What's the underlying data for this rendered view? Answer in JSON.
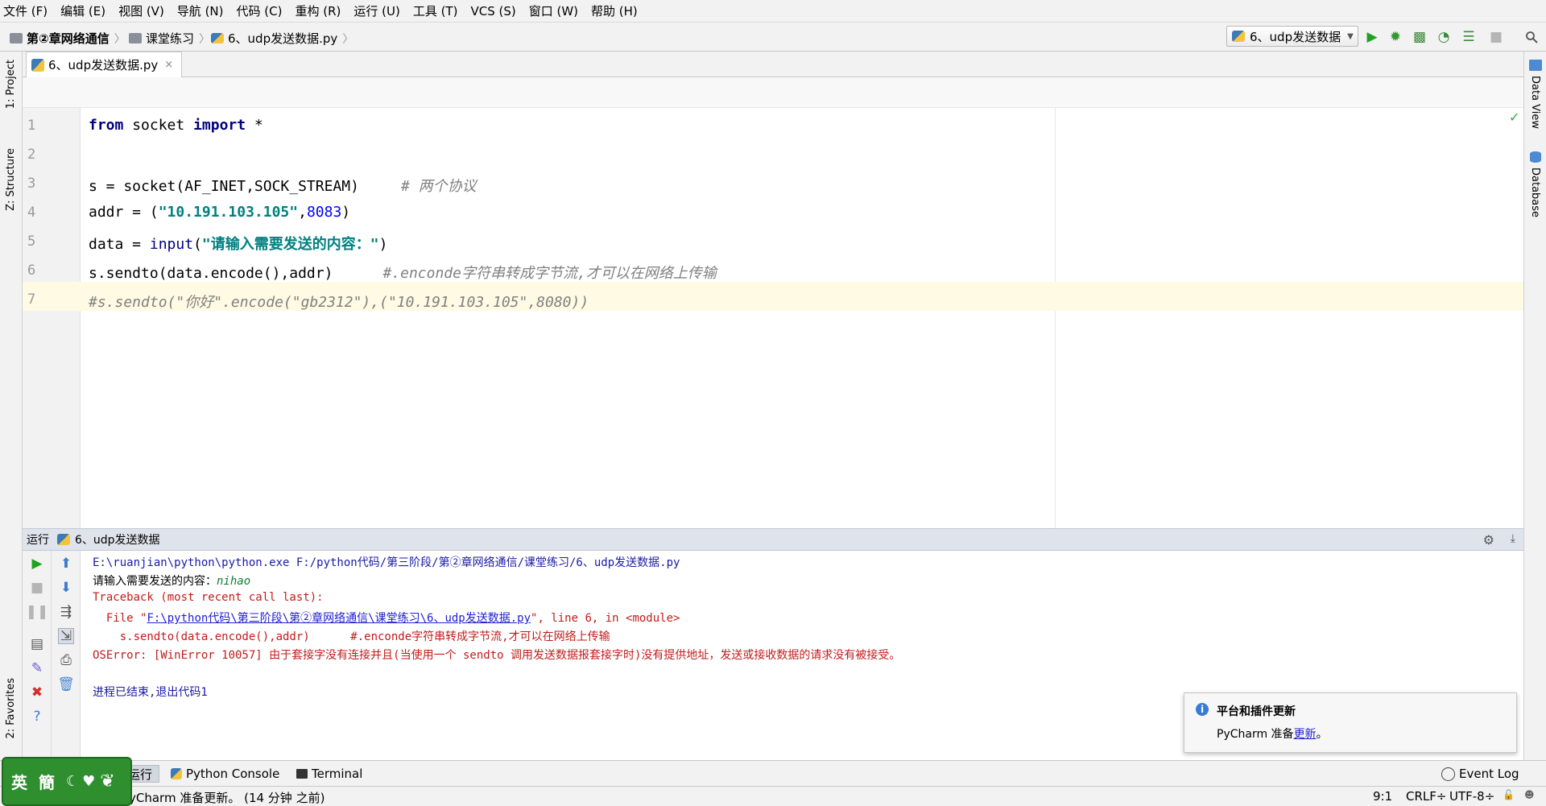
{
  "menu": [
    "文件 (F)",
    "编辑 (E)",
    "视图 (V)",
    "导航 (N)",
    "代码 (C)",
    "重构 (R)",
    "运行 (U)",
    "工具 (T)",
    "VCS (S)",
    "窗口 (W)",
    "帮助 (H)"
  ],
  "nav": {
    "crumb1": "第②章网络通信",
    "crumb2": "课堂练习",
    "crumb3": "6、udp发送数据.py",
    "sep": "〉"
  },
  "run_config": "6、udp发送数据",
  "run_config_arrow": "▼",
  "editor_tab": {
    "label": "6、udp发送数据.py",
    "close": "×"
  },
  "left_stripe": {
    "project": "1: Project",
    "structure": "Z: Structure",
    "favorites": "2: Favorites"
  },
  "right_stripe": {
    "dataview": "Data View",
    "database": "Database"
  },
  "code": {
    "line_numbers": [
      "1",
      "2",
      "3",
      "4",
      "5",
      "6",
      "7"
    ],
    "l1": {
      "kw1": "from",
      "mod": " socket ",
      "kw2": "import",
      "rest": " *"
    },
    "l3": {
      "code": "s = socket(AF_INET,SOCK_STREAM)",
      "cmt": "# 两个协议"
    },
    "l4": {
      "pre": "addr = (",
      "str": "\"10.191.103.105\"",
      "comma": ",",
      "num": "8083",
      "post": ")"
    },
    "l5": {
      "pre": "data = ",
      "bi": "input",
      "open": "(",
      "str": "\"请输入需要发送的内容：\"",
      "close": ")"
    },
    "l6": {
      "code": "s.sendto(data.encode(),addr)",
      "cmt": "#.enconde字符串转成字节流,才可以在网络上传输"
    },
    "l7": {
      "cmt": "#s.sendto(\"你好\".encode(\"gb2312\"),(\"10.191.103.105\",8080))"
    }
  },
  "run_panel": {
    "label": "运行",
    "config": "6、udp发送数据"
  },
  "console": {
    "cmd": "E:\\ruanjian\\python\\python.exe F:/python代码/第三阶段/第②章网络通信/课堂练习/6、udp发送数据.py",
    "prompt": "请输入需要发送的内容：",
    "input": "nihao",
    "tb": "Traceback (most recent call last):",
    "file_pre": "  File \"",
    "file_link": "F:\\python代码\\第三阶段\\第②章网络通信\\课堂练习\\6、udp发送数据.py",
    "file_post": "\", line 6, in <module>",
    "src": "    s.sendto(data.encode(),addr)      #.enconde字符串转成字节流,才可以在网络上传输",
    "err": "OSError: [WinError 10057] 由于套接字没有连接并且(当使用一个 sendto 调用发送数据报套接字时)没有提供地址，发送或接收数据的请求没有被接受。",
    "exit": "进程已结束,退出代码1"
  },
  "notification": {
    "title": "平台和插件更新",
    "text": "PyCharm 准备",
    "link": "更新",
    "end": "。",
    "info_icon": "i"
  },
  "bottom_tabs": {
    "run": "运行",
    "python_console": "Python Console",
    "terminal": "Terminal",
    "event_log": "Event Log"
  },
  "status": {
    "message": "yCharm 准备更新。 (14 分钟 之前)",
    "pos": "9:1",
    "crlf": "CRLF",
    "crlf_arrow": "÷",
    "enc": "UTF-8",
    "enc_arrow": "÷"
  },
  "ime": {
    "l1": "英",
    "l2": "簡"
  }
}
